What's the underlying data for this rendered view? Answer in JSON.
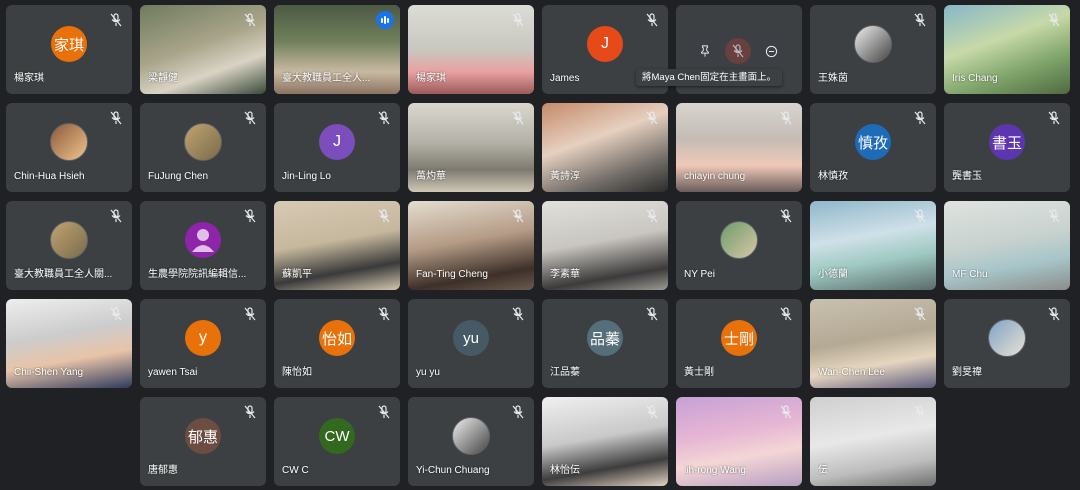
{
  "participants": [
    {
      "name": "楊家琪",
      "avatar_text": "家琪",
      "avatar_color": "#e8710a",
      "muted": true
    },
    {
      "name": "梁靜健",
      "video": true,
      "muted": true
    },
    {
      "name": "臺大教職員工全人...",
      "video": true,
      "speaking": true
    },
    {
      "name": "楊家琪",
      "video": true,
      "muted": true
    },
    {
      "name": "James",
      "avatar_text": "J",
      "avatar_color": "#e64a19",
      "muted": true
    },
    {
      "name": "",
      "avatar_text": "",
      "avatar_color": "#3c4043",
      "muted": true,
      "hovered": true
    },
    {
      "name": "王姝茵",
      "photo_avatar": true,
      "muted": true
    },
    {
      "name": "Iris Chang",
      "video": true,
      "muted": true
    },
    {
      "name": "Chin-Hua Hsieh",
      "photo_avatar": true,
      "muted": true
    },
    {
      "name": "FuJung Chen",
      "photo_avatar": true,
      "muted": true
    },
    {
      "name": "Jin-Ling Lo",
      "avatar_text": "J",
      "avatar_color": "#7c4dbd",
      "muted": true
    },
    {
      "name": "萬灼華",
      "video": true,
      "muted": true
    },
    {
      "name": "黃詩淳",
      "video": true,
      "muted": true
    },
    {
      "name": "chiayin chung",
      "video": true,
      "muted": true
    },
    {
      "name": "林慎孜",
      "avatar_text": "慎孜",
      "avatar_color": "#1e6bb8",
      "muted": true
    },
    {
      "name": "龔書玉",
      "avatar_text": "書玉",
      "avatar_color": "#5e35b1",
      "muted": true
    },
    {
      "name": "臺大教職員工全人關...",
      "photo_avatar": true,
      "muted": true
    },
    {
      "name": "生農學院院訊編輯信...",
      "avatar_text": "",
      "avatar_color": "#8e24aa",
      "muted": true
    },
    {
      "name": "蘇凱平",
      "video": true,
      "muted": true
    },
    {
      "name": "Fan-Ting Cheng",
      "video": true,
      "muted": true
    },
    {
      "name": "李素華",
      "video": true,
      "muted": true
    },
    {
      "name": "NY Pei",
      "photo_avatar": true,
      "muted": true
    },
    {
      "name": "小德蘭",
      "video": true,
      "muted": true
    },
    {
      "name": "MF Chu",
      "video": true,
      "muted": true
    },
    {
      "name": "Chii-Shen Yang",
      "video": true,
      "muted": true
    },
    {
      "name": "yawen Tsai",
      "avatar_text": "y",
      "avatar_color": "#e8710a",
      "muted": true
    },
    {
      "name": "陳怡如",
      "avatar_text": "怡如",
      "avatar_color": "#e8710a",
      "muted": true
    },
    {
      "name": "yu yu",
      "avatar_text": "yu",
      "avatar_color": "#455a64",
      "muted": true
    },
    {
      "name": "江品蓁",
      "avatar_text": "品蓁",
      "avatar_color": "#546e7a",
      "muted": true
    },
    {
      "name": "黃士剛",
      "avatar_text": "士剛",
      "avatar_color": "#e8710a",
      "muted": true
    },
    {
      "name": "Wan-Chen Lee",
      "video": true,
      "muted": true
    },
    {
      "name": "劉旻禕",
      "photo_avatar": true,
      "muted": true
    },
    {
      "name": "唐郁惠",
      "avatar_text": "郁惠",
      "avatar_color": "#6d4c41",
      "muted": true
    },
    {
      "name": "CW C",
      "avatar_text": "CW",
      "avatar_color": "#33691e",
      "muted": true
    },
    {
      "name": "Yi-Chun Chuang",
      "photo_avatar": true,
      "muted": true
    },
    {
      "name": "林怡伝",
      "video": true,
      "muted": true
    },
    {
      "name": "lih-rong Wang",
      "video": true,
      "muted": true
    },
    {
      "name": "伝",
      "video": true,
      "muted": true
    }
  ],
  "tooltip": "將Maya Chen固定在主畫面上。",
  "controls": {
    "pin": "pin-icon",
    "mute": "mic-off-icon",
    "remove": "remove-icon"
  },
  "colors": {
    "background": "#202124",
    "tile": "#3c4043",
    "accent": "#8ab4f8"
  }
}
